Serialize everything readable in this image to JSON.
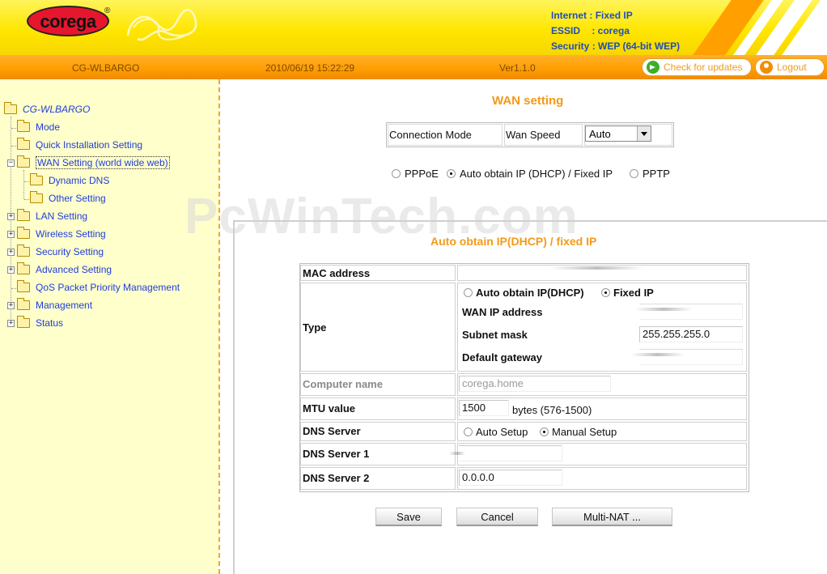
{
  "header": {
    "logo_text": "corega",
    "logo_mark": "®",
    "internet_label": "Internet",
    "internet_value": ": Fixed IP",
    "essid_label": "ESSID",
    "essid_value": ": corega",
    "security_label": "Security",
    "security_value": ": WEP (64-bit WEP)"
  },
  "statusbar": {
    "model": "CG-WLBARGO",
    "datetime": "2010/06/19 15:22:29",
    "version": "Ver1.1.0",
    "check_updates": "Check for updates",
    "logout": "Logout"
  },
  "sidebar": {
    "root": "CG-WLBARGO",
    "items": [
      {
        "label": "Mode"
      },
      {
        "label": "Quick Installation Setting"
      },
      {
        "label": "WAN Setting (world wide web)"
      },
      {
        "label": "Dynamic DNS"
      },
      {
        "label": "Other Setting"
      },
      {
        "label": "LAN Setting"
      },
      {
        "label": "Wireless Setting"
      },
      {
        "label": "Security Setting"
      },
      {
        "label": "Advanced Setting"
      },
      {
        "label": "QoS Packet Priority Management"
      },
      {
        "label": "Management"
      },
      {
        "label": "Status"
      }
    ]
  },
  "wan": {
    "title": "WAN setting",
    "connection_mode_label": "Connection Mode",
    "wan_speed_label": "Wan Speed",
    "wan_speed_value": "Auto",
    "mode_pppoe": "PPPoE",
    "mode_dhcp": "Auto obtain IP (DHCP) / Fixed IP",
    "mode_pptp": "PPTP",
    "watermark": "PcWinTech.com"
  },
  "dhcp_section": {
    "title": "Auto obtain IP(DHCP) / fixed IP",
    "mac_label": "MAC address",
    "type_label": "Type",
    "type_auto": "Auto obtain IP(DHCP)",
    "type_fixed": "Fixed IP",
    "wan_ip_label": "WAN IP address",
    "subnet_label": "Subnet mask",
    "subnet_value": "255.255.255.0",
    "gateway_label": "Default gateway",
    "computer_name_label": "Computer name",
    "computer_name_value": "corega.home",
    "mtu_label": "MTU value",
    "mtu_value": "1500",
    "mtu_hint": "bytes (576-1500)",
    "dns_label": "DNS Server",
    "dns_auto": "Auto Setup",
    "dns_manual": "Manual Setup",
    "dns1_label": "DNS Server 1",
    "dns2_label": "DNS Server 2",
    "dns2_value": "0.0.0.0"
  },
  "buttons": {
    "save": "Save",
    "cancel": "Cancel",
    "multinat": "Multi-NAT ..."
  }
}
